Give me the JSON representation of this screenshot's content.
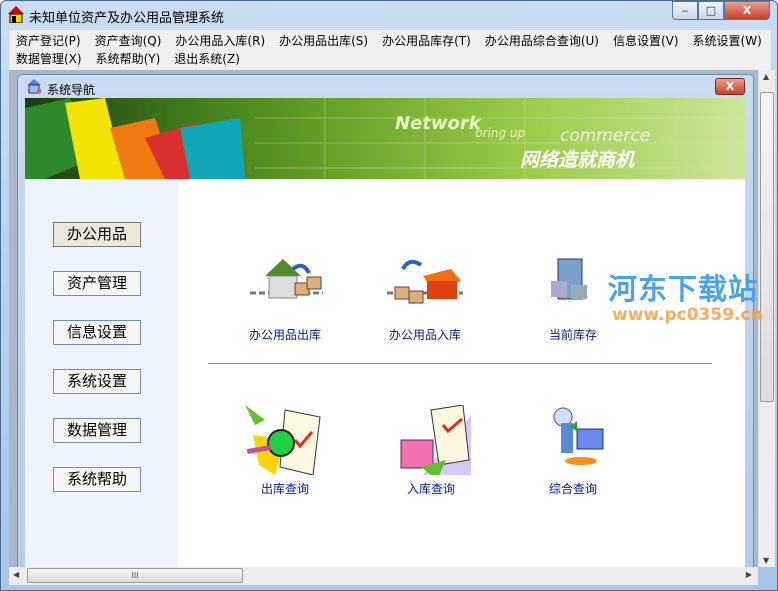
{
  "window": {
    "title": "未知单位资产及办公用品管理系统",
    "minimize": "‒",
    "maximize": "□",
    "close": "X"
  },
  "menu": {
    "row1": [
      "资产登记(P)",
      "资产查询(Q)",
      "办公用品入库(R)",
      "办公用品出库(S)",
      "办公用品库存(T)",
      "办公用品综合查询(U)",
      "信息设置(V)",
      "系统设置(W)"
    ],
    "row2": [
      "数据管理(X)",
      "系统帮助(Y)",
      "退出系统(Z)"
    ]
  },
  "child": {
    "title": "系统导航",
    "close": "X"
  },
  "banner": {
    "en1": "Network",
    "en2": "bring up",
    "en3": "commerce",
    "cn": "网络造就商机"
  },
  "nav": [
    "办公用品",
    "资产管理",
    "信息设置",
    "系统设置",
    "数据管理",
    "系统帮助"
  ],
  "tiles_top": [
    "办公用品出库",
    "办公用品入库",
    "当前库存"
  ],
  "tiles_bottom": [
    "出库查询",
    "入库查询",
    "综合查询"
  ],
  "watermark": {
    "name": "河东下载站",
    "url": "www.pc0359.cn"
  }
}
